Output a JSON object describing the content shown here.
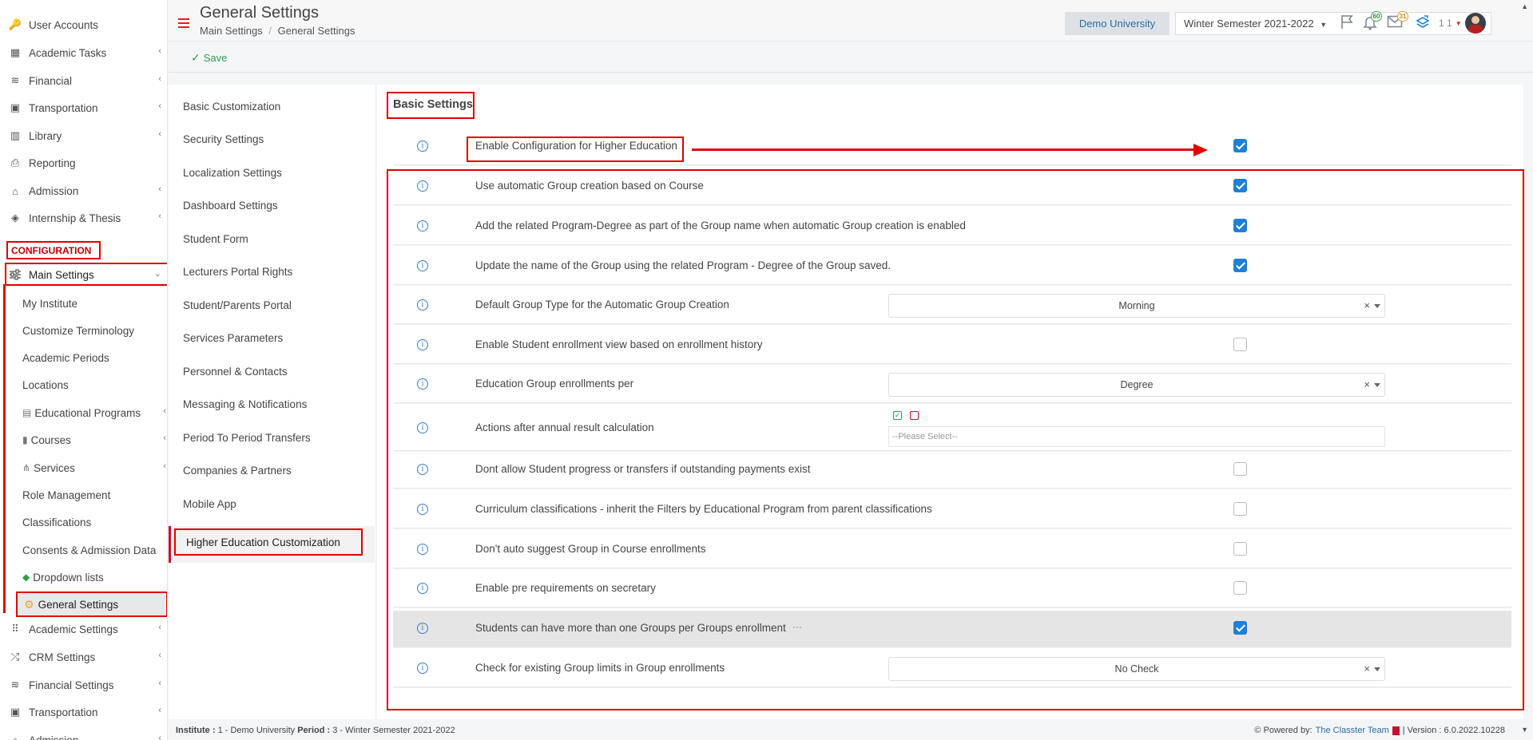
{
  "sidebar": {
    "top_items": [
      {
        "label": "User Accounts",
        "icon": "key-icon",
        "chevron": false
      },
      {
        "label": "Academic Tasks",
        "icon": "grid-icon",
        "chevron": true
      },
      {
        "label": "Financial",
        "icon": "coins-icon",
        "chevron": true
      },
      {
        "label": "Transportation",
        "icon": "bus-icon",
        "chevron": true
      },
      {
        "label": "Library",
        "icon": "books-icon",
        "chevron": true
      },
      {
        "label": "Reporting",
        "icon": "printer-icon",
        "chevron": false
      },
      {
        "label": "Admission",
        "icon": "bank-icon",
        "chevron": true
      },
      {
        "label": "Internship & Thesis",
        "icon": "cube-icon",
        "chevron": true
      }
    ],
    "section_title": "CONFIGURATION",
    "main_settings_label": "Main Settings",
    "sub_items": [
      {
        "label": "My Institute",
        "icon": "",
        "chevron": false
      },
      {
        "label": "Customize Terminology",
        "icon": "",
        "chevron": false
      },
      {
        "label": "Academic Periods",
        "icon": "",
        "chevron": false
      },
      {
        "label": "Locations",
        "icon": "",
        "chevron": false
      },
      {
        "label": "Educational Programs",
        "icon": "list-icon",
        "chevron": true
      },
      {
        "label": "Courses",
        "icon": "book-icon",
        "chevron": true
      },
      {
        "label": "Services",
        "icon": "network-icon",
        "chevron": true
      },
      {
        "label": "Role Management",
        "icon": "",
        "chevron": false
      },
      {
        "label": "Classifications",
        "icon": "",
        "chevron": false
      },
      {
        "label": "Consents & Admission Data",
        "icon": "",
        "chevron": false
      },
      {
        "label": "Dropdown lists",
        "icon": "layers-icon",
        "chevron": false
      }
    ],
    "general_settings_label": "General Settings",
    "bottom_items": [
      {
        "label": "Academic Settings",
        "icon": "people-icon",
        "chevron": true
      },
      {
        "label": "CRM Settings",
        "icon": "shuffle-icon",
        "chevron": true
      },
      {
        "label": "Financial Settings",
        "icon": "coins-icon",
        "chevron": true
      },
      {
        "label": "Transportation",
        "icon": "bus-icon",
        "chevron": true
      },
      {
        "label": "Admission",
        "icon": "bank-icon",
        "chevron": true
      }
    ]
  },
  "header": {
    "title": "General Settings",
    "breadcrumb": [
      "Main Settings",
      "General Settings"
    ],
    "institution": "Demo University",
    "period": "Winter Semester 2021-2022",
    "notifications_count": "60",
    "messages_count": "31",
    "user_label": "1 1"
  },
  "toolbar": {
    "save_label": "Save"
  },
  "settings_nav": {
    "items": [
      "Basic Customization",
      "Security Settings",
      "Localization Settings",
      "Dashboard Settings",
      "Student Form",
      "Lecturers Portal Rights",
      "Student/Parents Portal",
      "Services Parameters",
      "Personnel & Contacts",
      "Messaging & Notifications",
      "Period To Period Transfers",
      "Companies & Partners",
      "Mobile App"
    ],
    "active_item": "Higher Education Customization"
  },
  "main": {
    "section_title": "Basic Settings",
    "rows": [
      {
        "label": "Enable Configuration for Higher Education",
        "type": "checkbox",
        "checked": true
      },
      {
        "label": "Use automatic Group creation based on Course",
        "type": "checkbox",
        "checked": true
      },
      {
        "label": "Add the related Program-Degree as part of the Group name when automatic Group creation is enabled",
        "type": "checkbox",
        "checked": true
      },
      {
        "label": "Update the name of the Group using the related Program - Degree of the Group saved.",
        "type": "checkbox",
        "checked": true
      },
      {
        "label": "Default Group Type for the Automatic Group Creation",
        "type": "select",
        "value": "Morning"
      },
      {
        "label": "Enable Student enrollment view based on enrollment history",
        "type": "checkbox",
        "checked": false
      },
      {
        "label": "Education Group enrollments per",
        "type": "select",
        "value": "Degree"
      },
      {
        "label": "Actions after annual result calculation",
        "type": "multiselect",
        "placeholder": "--Please Select--"
      },
      {
        "label": "Dont allow Student progress or transfers if outstanding payments exist",
        "type": "checkbox",
        "checked": false
      },
      {
        "label": "Curriculum classifications - inherit the Filters by Educational Program from parent classifications",
        "type": "checkbox",
        "checked": false
      },
      {
        "label": "Don't auto suggest Group in Course enrollments",
        "type": "checkbox",
        "checked": false
      },
      {
        "label": "Enable pre requirements on secretary",
        "type": "checkbox",
        "checked": false
      },
      {
        "label": "Students can have more than one Groups per Groups enrollment",
        "type": "checkbox",
        "checked": true,
        "highlighted": true,
        "more": "···"
      },
      {
        "label": "Check for existing Group limits in Group enrollments",
        "type": "select",
        "value": "No Check"
      }
    ]
  },
  "footer": {
    "institute_key": "Institute :",
    "institute_value": "1 - Demo University",
    "period_key": "Period :",
    "period_value": "3 - Winter Semester 2021-2022",
    "powered_by": "Powered by:",
    "team": "The Classter Team",
    "version": "| Version : 6.0.2022.10228"
  },
  "colors": {
    "accent": "#1e80d8",
    "annotation": "#e00000",
    "save": "#2e9d4e"
  }
}
